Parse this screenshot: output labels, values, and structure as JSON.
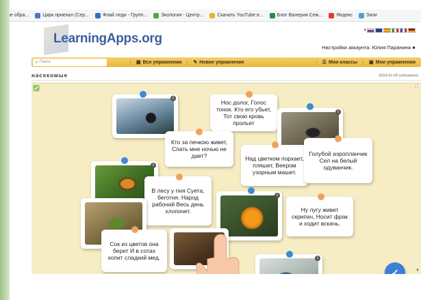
{
  "bookmarks": [
    {
      "label": "ое обра...",
      "color": "#ffffff"
    },
    {
      "label": "Цирк приехал (Сер...",
      "color": "#4a74c9"
    },
    {
      "label": "Флай леди - Групп...",
      "color": "#2c6fd1"
    },
    {
      "label": "Экология - Центр...",
      "color": "#5aa342"
    },
    {
      "label": "Скачать YouTube в...",
      "color": "#e8b52a"
    },
    {
      "label": "Блог Валерия Сем...",
      "color": "#2a8c3a"
    },
    {
      "label": "Яндекс",
      "color": "#e63a2a"
    },
    {
      "label": "Запи",
      "color": "#4aa0d8"
    }
  ],
  "site": {
    "logo": "LearningApps.org",
    "account": "Настройки аккаунта: Юлия Паранина",
    "flags": [
      "ru",
      "gb",
      "es",
      "it",
      "fr",
      "de"
    ]
  },
  "nav": {
    "search_placeholder": "Поиск",
    "all_exercises": "Все упражнения",
    "new_exercise": "Новое упражнение",
    "my_classes": "Мои классы",
    "my_exercises": "Мои упражнения"
  },
  "page": {
    "title": "насекомые",
    "date": "2019-01-05 (обновлен)"
  },
  "cards": {
    "t1": "Нос долог, Голос тонок. Кто его убьет, Тот свою кровь прольет",
    "t2": "Кто за печкою живет, Спать мне ночью не дает?",
    "t3": "Над цветком порхает, пляшет, Веером узорным машет.",
    "t4": "Голубой аэропланчик Сел на белый одуванчик.",
    "t5": "В лесу у пня Суета, беготня. Народ рабочий Весь день хлопочет.",
    "t6": "Ну лугу живет скрипач, Носит фрак и ходит вскачь.",
    "t7": "Сок из цветов она берет И в сотах копит сладкий мед."
  },
  "ui": {
    "info": "i",
    "fab": "✓",
    "expand": "⛶",
    "scroll": "▼"
  }
}
